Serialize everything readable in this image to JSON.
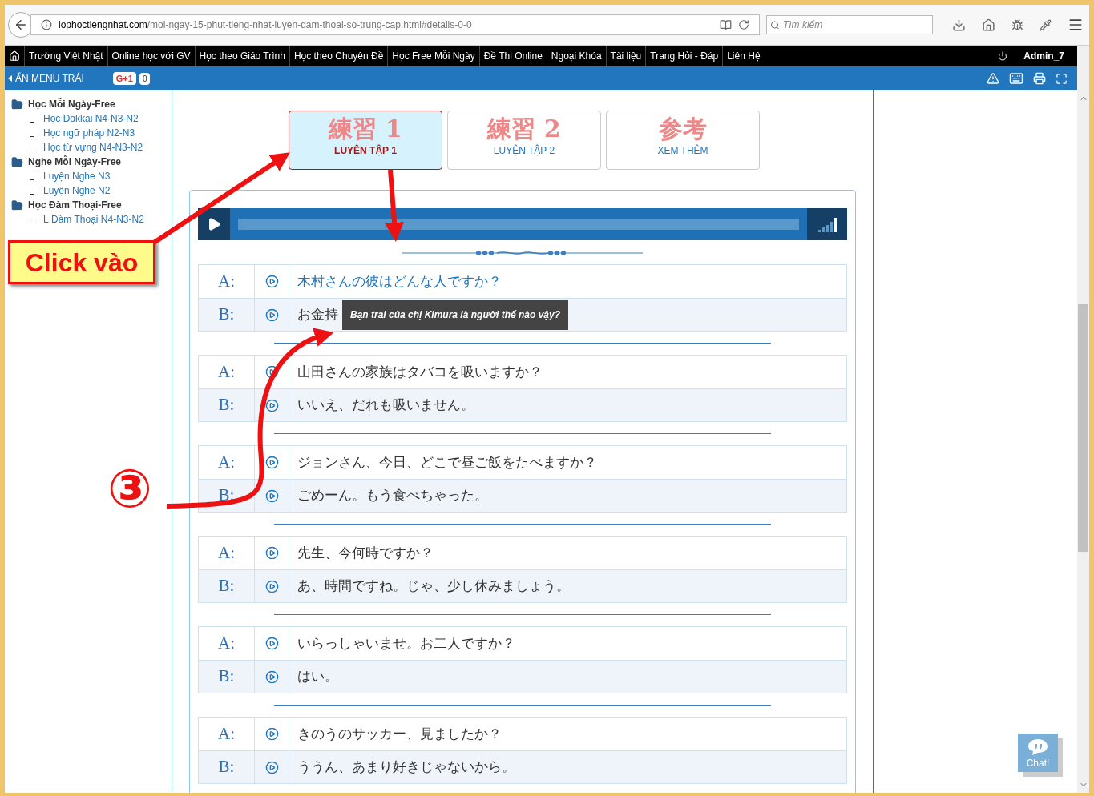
{
  "browser": {
    "url_domain": "lophoctiengnhat.com",
    "url_path": "/moi-ngay-15-phut-tieng-nhat-luyen-dam-thoai-so-trung-cap.html#details-0-0",
    "search_placeholder": "Tìm kiếm"
  },
  "nav": {
    "items": [
      "Trường Việt Nhật",
      "Online học với GV",
      "Học theo Giáo Trình",
      "Học theo Chuyên Đề",
      "Học Free Mỗi Ngày",
      "Đề Thi Online",
      "Ngoại Khóa",
      "Tài liệu",
      "Trang Hỏi - Đáp",
      "Liên Hệ"
    ],
    "user": "Admin_7"
  },
  "subbar": {
    "hide_menu": "ẨN MENU TRÁI",
    "gplus": "G+1",
    "gplus_count": "0"
  },
  "sidebar": [
    {
      "title": "Học Mỗi Ngày-Free",
      "children": [
        "Học Dokkai N4-N3-N2",
        "Học ngữ pháp N2-N3",
        "Học từ vựng N4-N3-N2"
      ]
    },
    {
      "title": "Nghe Mỗi Ngày-Free",
      "children": [
        "Luyện Nghe N3",
        "Luyện Nghe N2"
      ]
    },
    {
      "title": "Học Đàm Thoại-Free",
      "children": [
        "L.Đàm Thoại N4-N3-N2"
      ]
    }
  ],
  "tabs": [
    {
      "kanji": "練習 1",
      "label": "LUYỆN TẬP 1",
      "selected": true
    },
    {
      "kanji": "練習 2",
      "label": "LUYỆN TẬP 2",
      "selected": false
    },
    {
      "kanji": "参考",
      "label": "XEM THÊM",
      "selected": false
    }
  ],
  "dialogues": [
    [
      {
        "speaker": "A:",
        "text": "木村さんの彼はどんな人ですか？",
        "active": true
      },
      {
        "speaker": "B:",
        "text": "お金持",
        "active": false
      }
    ],
    [
      {
        "speaker": "A:",
        "text": "山田さんの家族はタバコを吸いますか？",
        "active": false
      },
      {
        "speaker": "B:",
        "text": "いいえ、だれも吸いません。",
        "active": false
      }
    ],
    [
      {
        "speaker": "A:",
        "text": "ジョンさん、今日、どこで昼ご飯をたべますか？",
        "active": false
      },
      {
        "speaker": "B:",
        "text": "ごめーん。もう食べちゃった。",
        "active": false
      }
    ],
    [
      {
        "speaker": "A:",
        "text": "先生、今何時ですか？",
        "active": false
      },
      {
        "speaker": "B:",
        "text": "あ、時間ですね。じゃ、少し休みましょう。",
        "active": false
      }
    ],
    [
      {
        "speaker": "A:",
        "text": "いらっしゃいませ。お二人ですか？",
        "active": false
      },
      {
        "speaker": "B:",
        "text": "はい。",
        "active": false
      }
    ],
    [
      {
        "speaker": "A:",
        "text": "きのうのサッカー、見ましたか？",
        "active": false
      },
      {
        "speaker": "B:",
        "text": "ううん、あまり好きじゃないから。",
        "active": false
      }
    ]
  ],
  "tooltip": "Bạn trai của chị Kimura là người thế nào vậy?",
  "chat": "Chat!",
  "annotations": {
    "click_label": "Click vào",
    "step": "③"
  }
}
